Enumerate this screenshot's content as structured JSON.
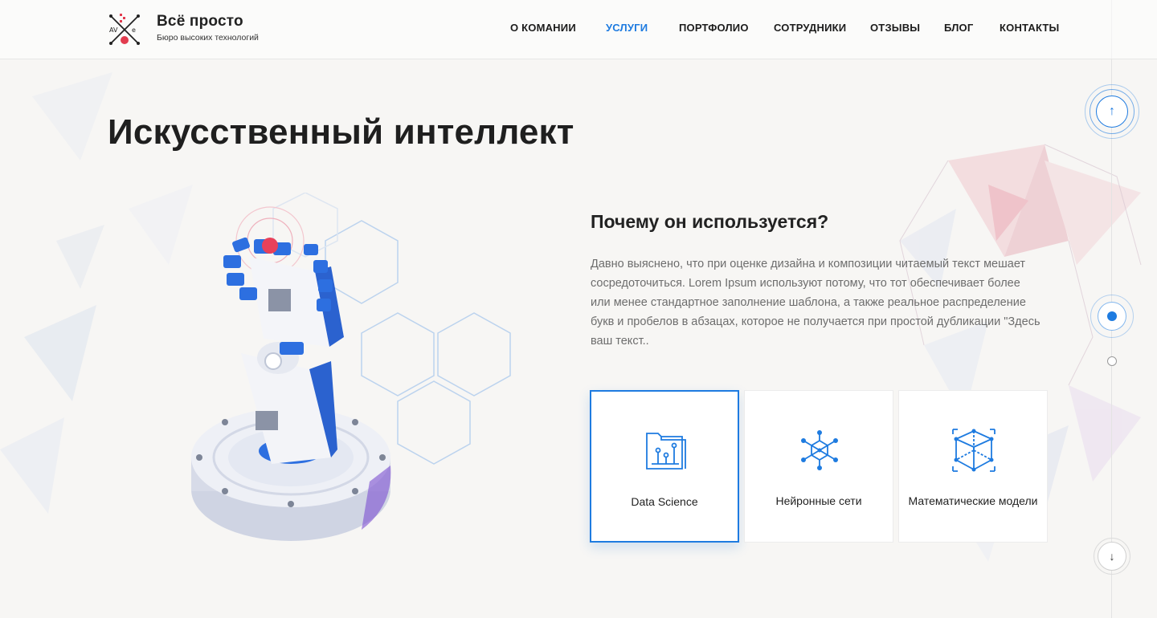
{
  "brand": {
    "name": "Всё просто",
    "tagline": "Бюро высоких технологий"
  },
  "nav": {
    "items": [
      {
        "label": "О КОМАНИИ",
        "active": false
      },
      {
        "label": "УСЛУГИ",
        "active": true
      },
      {
        "label": "ПОРТФОЛИО",
        "active": false
      },
      {
        "label": "СОТРУДНИКИ",
        "active": false
      },
      {
        "label": "ОТЗЫВЫ",
        "active": false
      },
      {
        "label": "БЛОГ",
        "active": false
      },
      {
        "label": "КОНТАКТЫ",
        "active": false
      }
    ]
  },
  "hero": {
    "title": "Искусственный интеллект"
  },
  "section": {
    "subtitle": "Почему он используется?",
    "paragraph": "Давно выяснено, что при оценке дизайна и композиции читаемый текст мешает сосредоточиться. Lorem Ipsum используют потому, что тот обеспечивает более или менее стандартное заполнение шаблона, а также реальное распределение букв и пробелов в абзацах, которое не получается при простой дубликации \"Здесь ваш текст.."
  },
  "cards": [
    {
      "label": "Data Science",
      "icon": "data-science-icon",
      "active": true
    },
    {
      "label": "Нейронные сети",
      "icon": "neural-network-icon",
      "active": false
    },
    {
      "label": "Математические модели",
      "icon": "cube-model-icon",
      "active": false
    }
  ],
  "side_nav": {
    "up_icon": "↑",
    "down_icon": "↓"
  },
  "colors": {
    "accent": "#1e7be0",
    "text": "#222222",
    "muted": "#6d6d6d"
  }
}
